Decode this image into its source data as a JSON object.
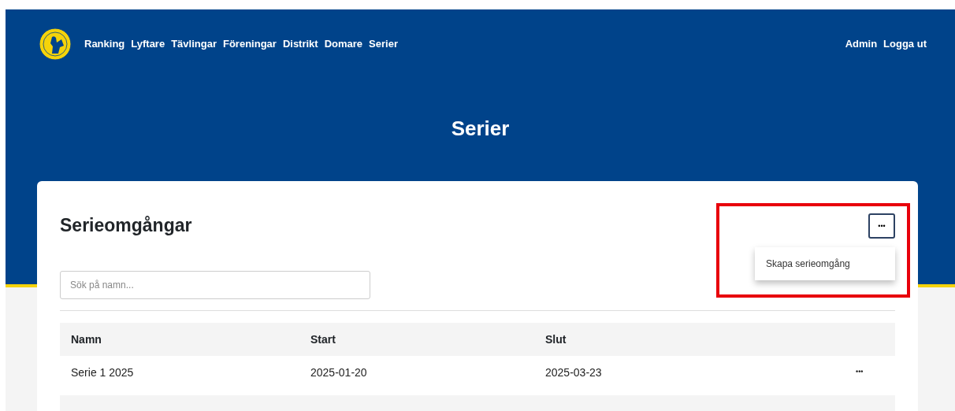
{
  "nav": {
    "links": [
      "Ranking",
      "Lyftare",
      "Tävlingar",
      "Föreningar",
      "Distrikt",
      "Domare",
      "Serier"
    ],
    "right_links": [
      "Admin",
      "Logga ut"
    ]
  },
  "page_title": "Serier",
  "card": {
    "title": "Serieomgångar",
    "menu": {
      "button": "•••",
      "expanded": true,
      "items": [
        "Skapa serieomgång"
      ],
      "highlighted": true
    },
    "search": {
      "placeholder": "Sök på namn..."
    },
    "table": {
      "columns": [
        "Namn",
        "Start",
        "Slut"
      ],
      "rows": [
        {
          "cells": [
            "Serie 1 2025",
            "2025-01-20",
            "2025-03-23"
          ],
          "action": "•••"
        },
        {
          "cells": [],
          "action": ""
        }
      ]
    }
  }
}
